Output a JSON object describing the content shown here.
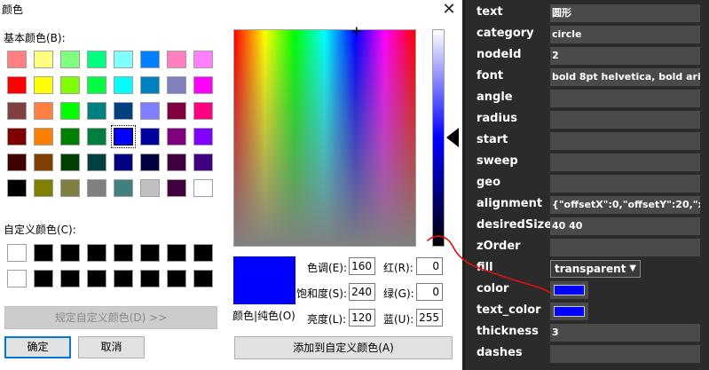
{
  "dialog": {
    "title": "颜色",
    "close_glyph": "✕",
    "basic_colors_label": "基本颜色(B):",
    "basic_colors": [
      [
        "#ff8080",
        "#ffff80",
        "#80ff80",
        "#00ff80",
        "#80ffff",
        "#0080ff",
        "#ff80c0",
        "#ff80ff"
      ],
      [
        "#ff0000",
        "#ffff00",
        "#80ff00",
        "#00ff40",
        "#00ffff",
        "#0080c0",
        "#8080c0",
        "#ff00ff"
      ],
      [
        "#804040",
        "#ff8040",
        "#00ff00",
        "#008080",
        "#004080",
        "#8080ff",
        "#800040",
        "#ff0080"
      ],
      [
        "#800000",
        "#ff8000",
        "#008000",
        "#008040",
        "#0000ff",
        "#0000a0",
        "#800080",
        "#8000ff"
      ],
      [
        "#400000",
        "#804000",
        "#004000",
        "#004040",
        "#000080",
        "#000040",
        "#400040",
        "#400080"
      ],
      [
        "#000000",
        "#808000",
        "#808040",
        "#808080",
        "#408080",
        "#c0c0c0",
        "#400040",
        "#ffffff"
      ]
    ],
    "selected_basic_color": "#0000ff",
    "custom_colors_label": "自定义颜色(C):",
    "custom_colors": [
      [
        "#ffffff",
        "#000000",
        "#000000",
        "#000000",
        "#000000",
        "#000000",
        "#000000",
        "#000000"
      ],
      [
        "#ffffff",
        "#000000",
        "#000000",
        "#000000",
        "#000000",
        "#000000",
        "#000000",
        "#000000"
      ]
    ],
    "define_custom_button": "规定自定义颜色(D) >>",
    "ok_button": "确定",
    "cancel_button": "取消",
    "preview_label": "颜色|纯色(O)",
    "preview_color": "#0000ff",
    "hue_label": "色调(E):",
    "hue_value": "160",
    "sat_label": "饱和度(S):",
    "sat_value": "240",
    "lum_label": "亮度(L):",
    "lum_value": "120",
    "red_label": "红(R):",
    "red_value": "0",
    "green_label": "绿(G):",
    "green_value": "0",
    "blue_label": "蓝(U):",
    "blue_value": "255",
    "add_custom_button": "添加到自定义颜色(A)",
    "crosshair_glyph": "✛",
    "annotation_color": "#e01010"
  },
  "properties": {
    "rows": [
      {
        "label": "text",
        "value": "圆形"
      },
      {
        "label": "category",
        "value": "circle"
      },
      {
        "label": "nodeId",
        "value": "2"
      },
      {
        "label": "font",
        "value": "bold 8pt helvetica, bold arial,"
      },
      {
        "label": "angle",
        "value": ""
      },
      {
        "label": "radius",
        "value": ""
      },
      {
        "label": "start",
        "value": ""
      },
      {
        "label": "sweep",
        "value": ""
      },
      {
        "label": "geo",
        "value": ""
      },
      {
        "label": "alignment",
        "value": "{\"offsetX\":0,\"offsetY\":20,\"x\":"
      },
      {
        "label": "desiredSize",
        "value": "40 40"
      },
      {
        "label": "zOrder",
        "value": ""
      },
      {
        "label": "fill",
        "value": "transparent"
      },
      {
        "label": "color",
        "value": "#0000ff"
      },
      {
        "label": "text_color",
        "value": "#0000ff"
      },
      {
        "label": "thickness",
        "value": "3"
      },
      {
        "label": "dashes",
        "value": ""
      }
    ],
    "fill_arrow": "▼"
  }
}
